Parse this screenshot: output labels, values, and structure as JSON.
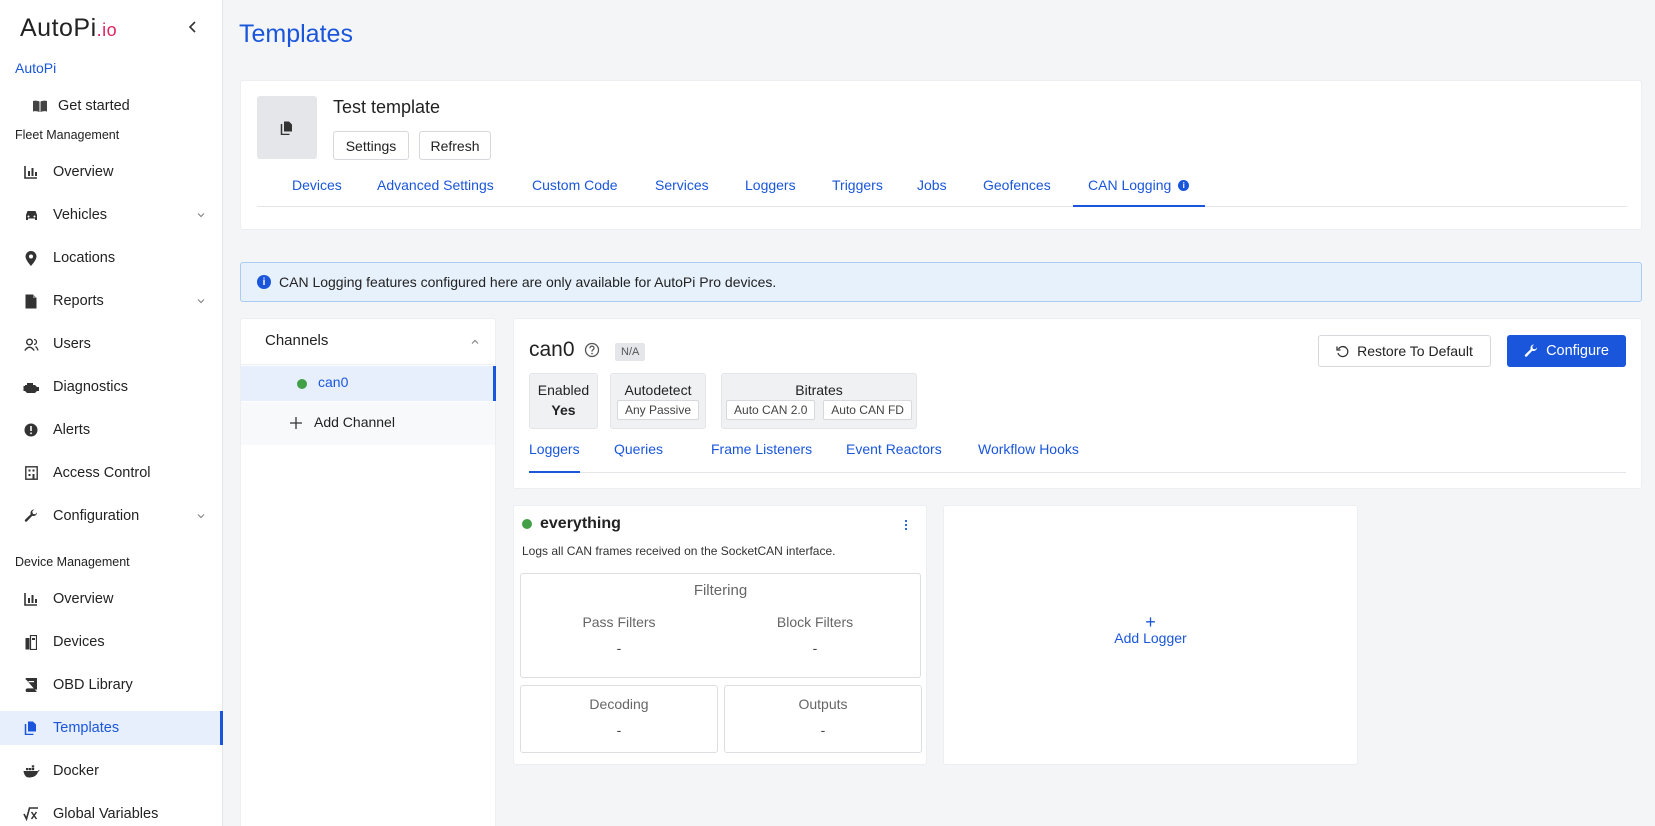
{
  "sidebar": {
    "logo": {
      "main": "AutoPi",
      "suffix": ".io"
    },
    "org": "AutoPi",
    "get_started": "Get started",
    "sections": {
      "fleet": "Fleet Management",
      "device": "Device Management"
    },
    "fleet_items": [
      {
        "label": "Overview",
        "icon": "chart-icon"
      },
      {
        "label": "Vehicles",
        "icon": "car-icon",
        "expandable": true
      },
      {
        "label": "Locations",
        "icon": "location-pin-icon"
      },
      {
        "label": "Reports",
        "icon": "document-icon",
        "expandable": true
      },
      {
        "label": "Users",
        "icon": "users-icon"
      },
      {
        "label": "Diagnostics",
        "icon": "engine-icon"
      },
      {
        "label": "Alerts",
        "icon": "alert-icon"
      },
      {
        "label": "Access Control",
        "icon": "access-icon"
      },
      {
        "label": "Configuration",
        "icon": "wrench-icon",
        "expandable": true
      }
    ],
    "device_items": [
      {
        "label": "Overview",
        "icon": "chart-icon"
      },
      {
        "label": "Devices",
        "icon": "devices-icon"
      },
      {
        "label": "OBD Library",
        "icon": "book-icon"
      },
      {
        "label": "Templates",
        "icon": "templates-icon",
        "active": true
      },
      {
        "label": "Docker",
        "icon": "docker-icon"
      },
      {
        "label": "Global Variables",
        "icon": "variable-icon"
      }
    ]
  },
  "page": {
    "title": "Templates"
  },
  "template": {
    "name": "Test template",
    "buttons": {
      "settings": "Settings",
      "refresh": "Refresh"
    },
    "tabs": [
      "Devices",
      "Advanced Settings",
      "Custom Code",
      "Services",
      "Loggers",
      "Triggers",
      "Jobs",
      "Geofences",
      "CAN Logging"
    ],
    "active_tab": "CAN Logging"
  },
  "banner": {
    "text": "CAN Logging features configured here are only available for AutoPi Pro devices."
  },
  "channels": {
    "title": "Channels",
    "items": [
      {
        "label": "can0",
        "status_color": "#43a047"
      }
    ],
    "add_label": "Add Channel"
  },
  "channel": {
    "name": "can0",
    "badge": "N/A",
    "restore_label": "Restore To Default",
    "configure_label": "Configure",
    "enabled": {
      "title": "Enabled",
      "value": "Yes"
    },
    "autodetect": {
      "title": "Autodetect",
      "value": "Any Passive"
    },
    "bitrates": {
      "title": "Bitrates",
      "values": [
        "Auto CAN 2.0",
        "Auto CAN FD"
      ]
    },
    "subtabs": [
      "Loggers",
      "Queries",
      "Frame Listeners",
      "Event Reactors",
      "Workflow Hooks"
    ],
    "active_subtab": "Loggers"
  },
  "logger": {
    "name": "everything",
    "description": "Logs all CAN frames received on the SocketCAN interface.",
    "filtering": {
      "title": "Filtering",
      "pass_label": "Pass Filters",
      "pass_value": "-",
      "block_label": "Block Filters",
      "block_value": "-"
    },
    "decoding": {
      "title": "Decoding",
      "value": "-"
    },
    "outputs": {
      "title": "Outputs",
      "value": "-"
    }
  },
  "add_logger": {
    "plus": "+",
    "label": "Add Logger"
  },
  "colors": {
    "accent": "#1a56db",
    "status_green": "#43a047",
    "logo_io": "#e0245e"
  }
}
